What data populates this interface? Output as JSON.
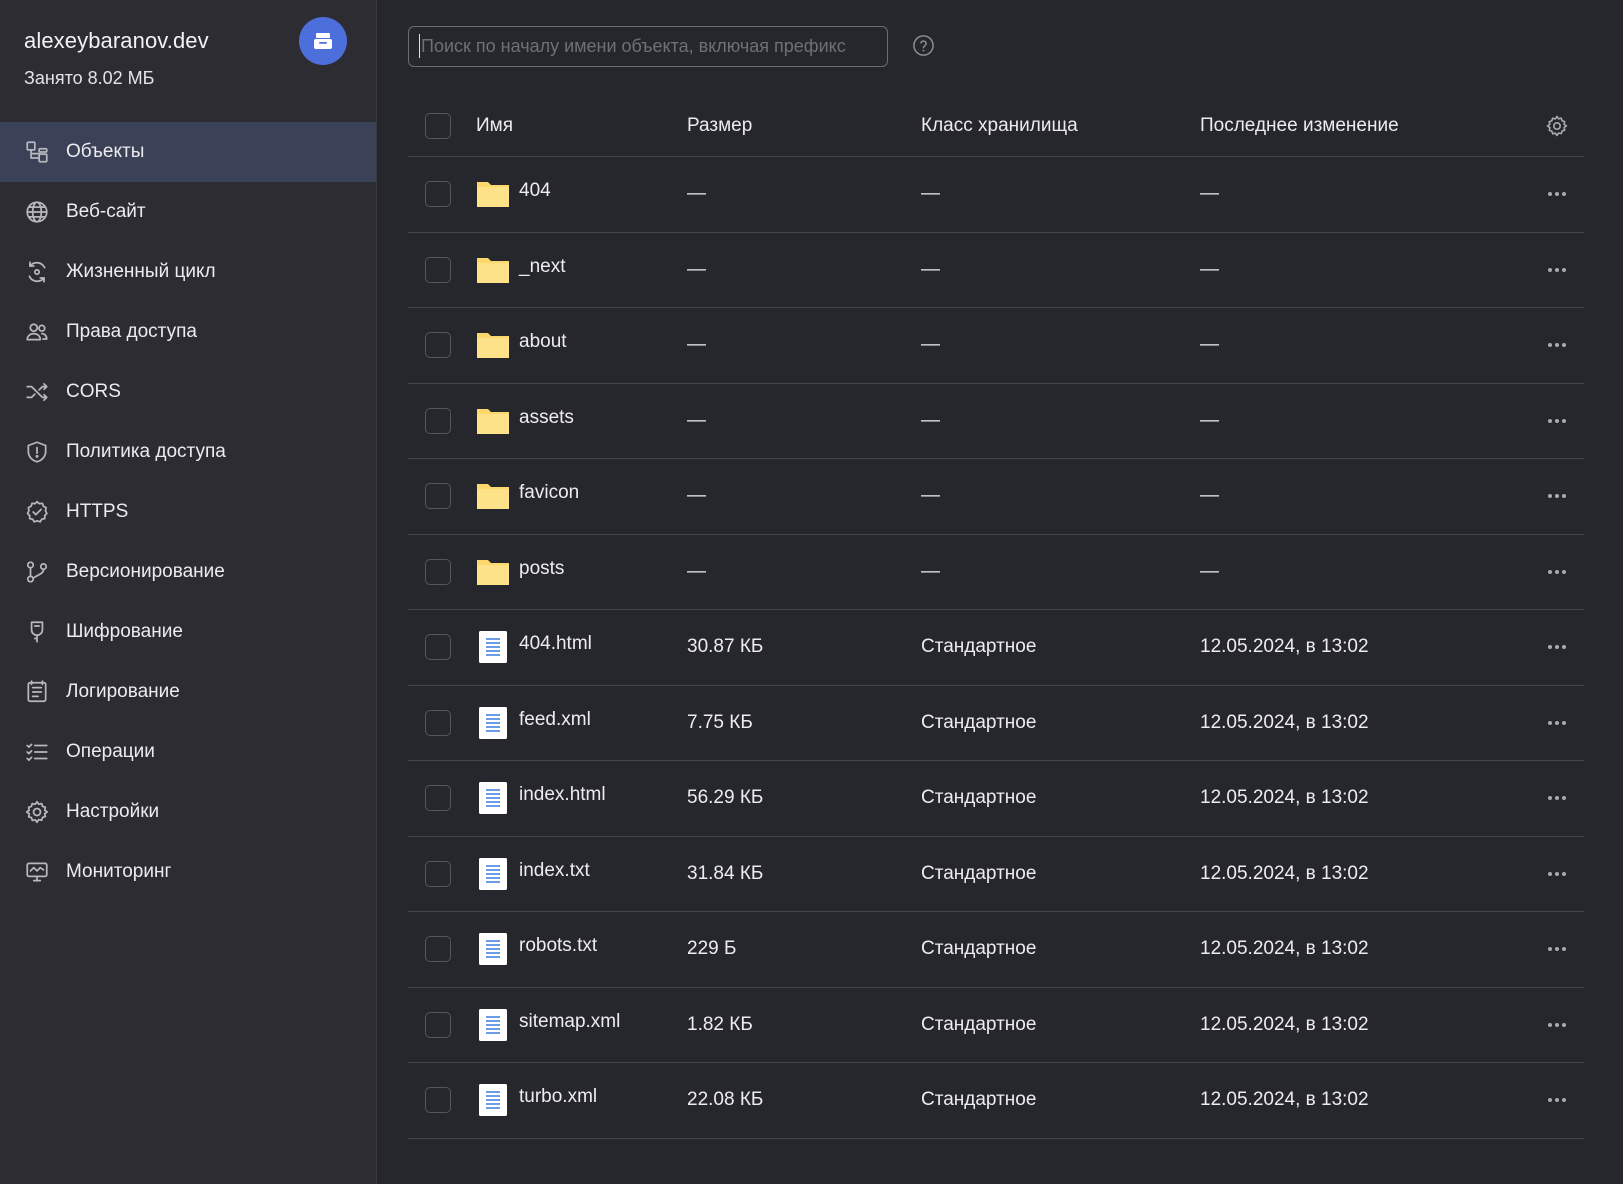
{
  "bucket": {
    "name": "alexeybaranov.dev",
    "usage": "Занято 8.02 МБ",
    "badge_icon": "bucket-icon",
    "accent": "#4d6fdc"
  },
  "sidebar": {
    "items": [
      {
        "label": "Объекты",
        "icon": "objects-icon",
        "active": true
      },
      {
        "label": "Веб-сайт",
        "icon": "globe-icon"
      },
      {
        "label": "Жизненный цикл",
        "icon": "lifecycle-icon"
      },
      {
        "label": "Права доступа",
        "icon": "users-icon"
      },
      {
        "label": "CORS",
        "icon": "shuffle-icon"
      },
      {
        "label": "Политика доступа",
        "icon": "shield-icon"
      },
      {
        "label": "HTTPS",
        "icon": "verified-icon"
      },
      {
        "label": "Версионирование",
        "icon": "branch-icon"
      },
      {
        "label": "Шифрование",
        "icon": "key-icon"
      },
      {
        "label": "Логирование",
        "icon": "log-icon"
      },
      {
        "label": "Операции",
        "icon": "list-icon"
      },
      {
        "label": "Настройки",
        "icon": "gear-icon"
      },
      {
        "label": "Мониторинг",
        "icon": "monitor-icon"
      }
    ]
  },
  "search": {
    "placeholder": "Поиск по началу имени объекта, включая префикс",
    "value": ""
  },
  "table": {
    "columns": {
      "name": "Имя",
      "size": "Размер",
      "class": "Класс хранилища",
      "modified": "Последнее изменение"
    },
    "rows": [
      {
        "type": "folder",
        "name": "404",
        "size": "—",
        "class": "—",
        "modified": "—"
      },
      {
        "type": "folder",
        "name": "_next",
        "size": "—",
        "class": "—",
        "modified": "—"
      },
      {
        "type": "folder",
        "name": "about",
        "size": "—",
        "class": "—",
        "modified": "—"
      },
      {
        "type": "folder",
        "name": "assets",
        "size": "—",
        "class": "—",
        "modified": "—"
      },
      {
        "type": "folder",
        "name": "favicon",
        "size": "—",
        "class": "—",
        "modified": "—"
      },
      {
        "type": "folder",
        "name": "posts",
        "size": "—",
        "class": "—",
        "modified": "—"
      },
      {
        "type": "file",
        "name": "404.html",
        "size": "30.87 КБ",
        "class": "Стандартное",
        "modified": "12.05.2024, в 13:02"
      },
      {
        "type": "file",
        "name": "feed.xml",
        "size": "7.75 КБ",
        "class": "Стандартное",
        "modified": "12.05.2024, в 13:02"
      },
      {
        "type": "file",
        "name": "index.html",
        "size": "56.29 КБ",
        "class": "Стандартное",
        "modified": "12.05.2024, в 13:02"
      },
      {
        "type": "file",
        "name": "index.txt",
        "size": "31.84 КБ",
        "class": "Стандартное",
        "modified": "12.05.2024, в 13:02"
      },
      {
        "type": "file",
        "name": "robots.txt",
        "size": "229 Б",
        "class": "Стандартное",
        "modified": "12.05.2024, в 13:02"
      },
      {
        "type": "file",
        "name": "sitemap.xml",
        "size": "1.82 КБ",
        "class": "Стандартное",
        "modified": "12.05.2024, в 13:02"
      },
      {
        "type": "file",
        "name": "turbo.xml",
        "size": "22.08 КБ",
        "class": "Стандартное",
        "modified": "12.05.2024, в 13:02"
      }
    ]
  },
  "colors": {
    "folder": "#fbd86c",
    "file_lines": "#3f7de0",
    "active_nav": "#3b4156"
  }
}
